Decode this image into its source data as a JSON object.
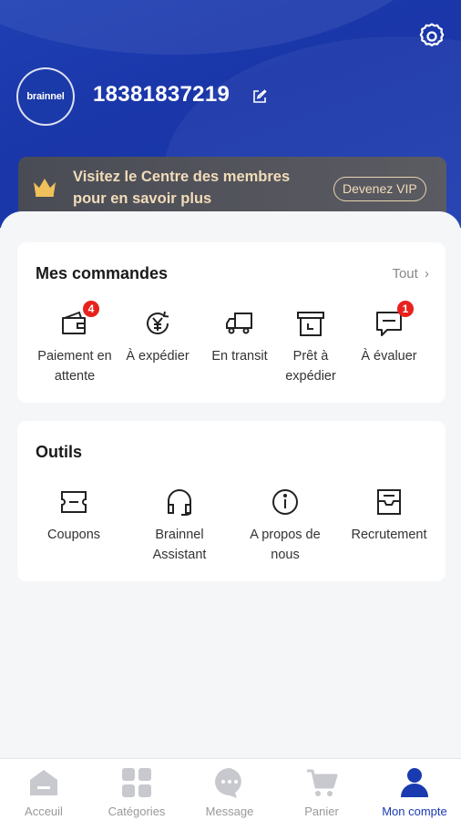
{
  "profile": {
    "avatar_text": "brainnel",
    "phone": "18381837219"
  },
  "vip": {
    "line1": "Visitez le Centre des membres",
    "line2": "pour en savoir plus",
    "button": "Devenez VIP"
  },
  "orders": {
    "title": "Mes commandes",
    "all_label": "Tout",
    "items": [
      {
        "label": "Paiement en attente",
        "badge": "4",
        "icon": "wallet-icon"
      },
      {
        "label": "À expédier",
        "badge": "",
        "icon": "yuan-cycle-icon"
      },
      {
        "label": "En transit",
        "badge": "",
        "icon": "truck-icon"
      },
      {
        "label": "Prêt à expédier",
        "badge": "",
        "icon": "box-icon"
      },
      {
        "label": "À évaluer",
        "badge": "1",
        "icon": "comment-icon"
      }
    ]
  },
  "tools": {
    "title": "Outils",
    "items": [
      {
        "label": "Coupons",
        "icon": "coupon-icon"
      },
      {
        "label": "Brainnel Assistant",
        "icon": "headset-icon"
      },
      {
        "label": "A propos de nous",
        "icon": "info-icon"
      },
      {
        "label": "Recrutement",
        "icon": "inbox-icon"
      }
    ]
  },
  "tabbar": {
    "items": [
      {
        "label": "Acceuil",
        "icon": "home-icon",
        "active": false
      },
      {
        "label": "Catégories",
        "icon": "grid-icon",
        "active": false
      },
      {
        "label": "Message",
        "icon": "chat-icon",
        "active": false
      },
      {
        "label": "Panier",
        "icon": "cart-icon",
        "active": false
      },
      {
        "label": "Mon compte",
        "icon": "user-icon",
        "active": true
      }
    ],
    "active_color": "#1a3aaf",
    "inactive_color": "#c7c9ce"
  }
}
